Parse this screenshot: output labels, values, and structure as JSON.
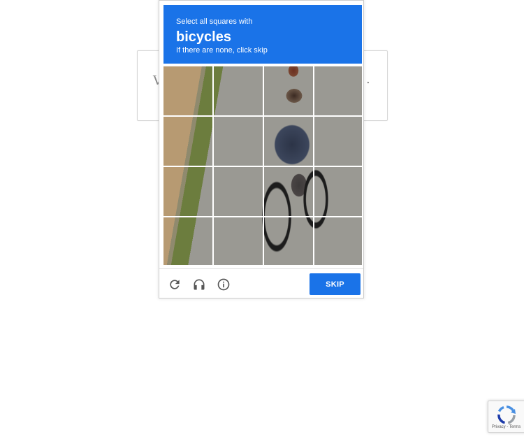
{
  "background_card": {
    "left_fragment": "V",
    "right_fragment": "."
  },
  "challenge": {
    "instruction_line1": "Select all squares with",
    "target": "bicycles",
    "instruction_line3": "If there are none, click skip",
    "grid": {
      "rows": 4,
      "columns": 4,
      "image_description_icon": "boy-riding-bicycle-photo"
    },
    "footer": {
      "reload_icon": "reload-icon",
      "audio_icon": "headphones-icon",
      "info_icon": "info-icon",
      "skip_label": "SKIP"
    }
  },
  "badge": {
    "logo_icon": "recaptcha-logo-icon",
    "terms": "Privacy - Terms"
  },
  "colors": {
    "accent": "#1a73e8",
    "footer_icon": "#555555",
    "border": "#cccccc"
  }
}
